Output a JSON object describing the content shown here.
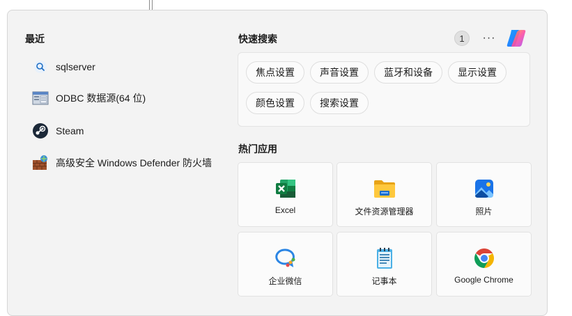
{
  "recent": {
    "title": "最近",
    "items": [
      {
        "label": "sqlserver",
        "icon": "search-icon"
      },
      {
        "label": "ODBC 数据源(64 位)",
        "icon": "odbc-icon"
      },
      {
        "label": "Steam",
        "icon": "steam-icon"
      },
      {
        "label": "高级安全 Windows Defender 防火墙",
        "icon": "firewall-icon"
      }
    ]
  },
  "quick_search": {
    "title": "快速搜索",
    "count": "1",
    "more": "···",
    "chips": [
      "焦点设置",
      "声音设置",
      "蓝牙和设备",
      "显示设置",
      "颜色设置",
      "搜索设置"
    ]
  },
  "top_apps": {
    "title": "热门应用",
    "apps": [
      {
        "label": "Excel",
        "icon": "excel-icon"
      },
      {
        "label": "文件资源管理器",
        "icon": "file-explorer-icon"
      },
      {
        "label": "照片",
        "icon": "photos-icon"
      },
      {
        "label": "企业微信",
        "icon": "wecom-icon"
      },
      {
        "label": "记事本",
        "icon": "notepad-icon"
      },
      {
        "label": "Google Chrome",
        "icon": "chrome-icon"
      }
    ]
  },
  "colors": {
    "excel": "#1d6f42",
    "folder": "#f6c343",
    "chrome_red": "#db4437",
    "chrome_green": "#0f9d58",
    "chrome_yellow": "#f4b400",
    "chrome_blue": "#4285f4"
  }
}
